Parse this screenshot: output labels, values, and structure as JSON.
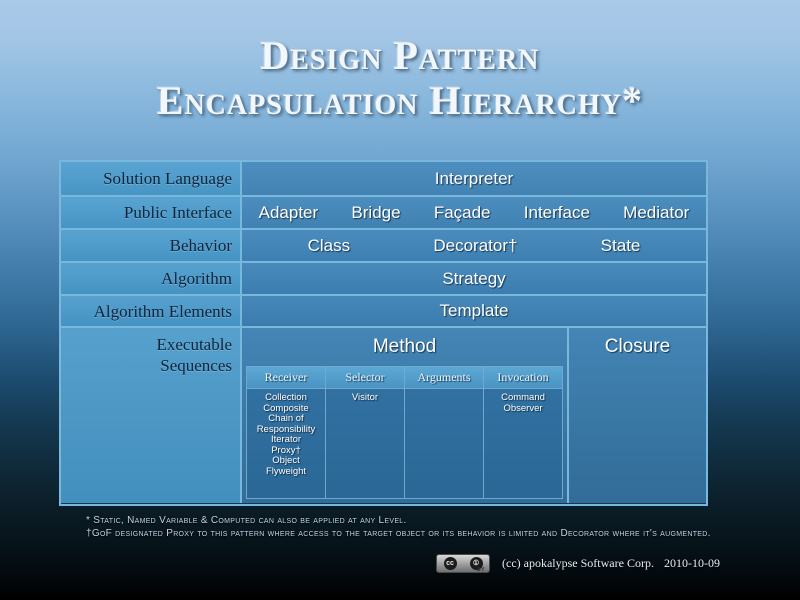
{
  "title": {
    "line1": "Design Pattern",
    "line2": "Encapsulation Hierarchy*"
  },
  "table": {
    "rows": [
      {
        "label": "Solution Language",
        "items": [
          "Interpreter"
        ]
      },
      {
        "label": "Public Interface",
        "items": [
          "Adapter",
          "Bridge",
          "Façade",
          "Interface",
          "Mediator"
        ]
      },
      {
        "label": "Behavior",
        "items": [
          "Class",
          "Decorator†",
          "State"
        ]
      },
      {
        "label": "Algorithm",
        "items": [
          "Strategy"
        ]
      },
      {
        "label": "Algorithm Elements",
        "items": [
          "Template"
        ]
      }
    ],
    "last_row": {
      "label_line1": "Executable",
      "label_line2": "Sequences",
      "method_title": "Method",
      "closure_title": "Closure",
      "subtable": {
        "headers": [
          "Receiver",
          "Selector",
          "Arguments",
          "Invocation"
        ],
        "cells": [
          [
            "Collection",
            "Composite",
            "Chain of Responsibility",
            "Iterator",
            "Proxy†",
            "Object",
            "Flyweight"
          ],
          [
            "Visitor"
          ],
          [],
          [
            "Command",
            "Observer"
          ]
        ]
      }
    }
  },
  "footnotes": {
    "line1": "* Static, Named Variable & Computed can also be applied at any Level.",
    "line2": "†GoF designated Proxy to this pattern where access to the target object or its behavior is limited and Decorator where it's augmented."
  },
  "footer": {
    "badge_cc": "cc",
    "badge_by": "BY",
    "copyright": "(cc) apokalypse Software Corp.",
    "date": "2010-10-09"
  },
  "colors": {
    "border": "#79b7dd",
    "label_bg": "#5aa5d2",
    "content_bg": "#4a8dbe",
    "title_text": "#f2f7fc"
  }
}
